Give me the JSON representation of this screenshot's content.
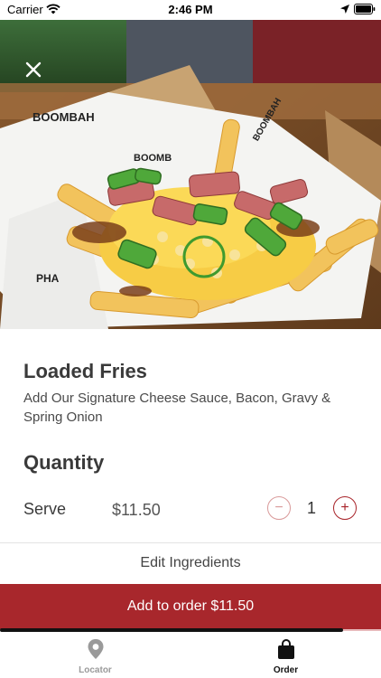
{
  "status_bar": {
    "carrier": "Carrier",
    "time": "2:46 PM",
    "icons": [
      "wifi-icon",
      "location-arrow-icon",
      "battery-icon"
    ]
  },
  "hero": {
    "image_subject": "loaded fries with cheese sauce, bacon, gravy and spring onion in a branded paper basket",
    "close_icon": "close-icon",
    "wrapper_text": [
      "BOOMBAH",
      "BOOMB",
      "BOOMBAH",
      "PHA"
    ]
  },
  "product": {
    "title": "Loaded Fries",
    "description": "Add Our Signature Cheese Sauce, Bacon, Gravy & Spring Onion"
  },
  "quantity": {
    "heading": "Quantity",
    "serve_label": "Serve",
    "price": "$11.50",
    "minus_symbol": "−",
    "value": "1",
    "plus_symbol": "+"
  },
  "actions": {
    "edit_ingredients": "Edit Ingredients",
    "add_to_order": "Add to order $11.50"
  },
  "tabs": [
    {
      "label": "Locator",
      "icon": "map-pin-icon",
      "active": false
    },
    {
      "label": "Order",
      "icon": "shopping-bag-icon",
      "active": true
    }
  ],
  "colors": {
    "accent": "#a8272c",
    "minus_border": "#d99a9a",
    "tab_inactive": "#9a9a9a",
    "tab_active": "#111111"
  }
}
